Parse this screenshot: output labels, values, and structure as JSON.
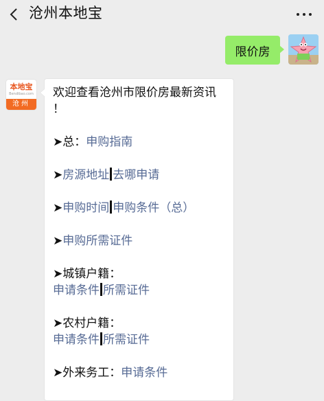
{
  "header": {
    "back_icon": "chevron-left-icon",
    "title": "沧州本地宝",
    "more_icon": "ellipsis-icon"
  },
  "outgoing_message": {
    "text": "限价房"
  },
  "account_avatar": {
    "logo_text": "本地宝",
    "logo_subtext": "Bendibao.com",
    "city": "沧州"
  },
  "reply": {
    "intro_line1": "欢迎查看沧州市限价房最新资讯",
    "intro_line2": "！",
    "items": [
      {
        "prefix": "➤总：",
        "links": [
          "申购指南"
        ]
      },
      {
        "prefix": "➤",
        "links": [
          "房源地址",
          "去哪申请"
        ]
      },
      {
        "prefix": "➤",
        "links": [
          "申购时间",
          "申购条件（总）"
        ]
      },
      {
        "prefix": "➤",
        "links": [
          "申购所需证件"
        ]
      },
      {
        "prefix": "➤城镇户籍：",
        "links": [
          "申请条件",
          "所需证件"
        ]
      },
      {
        "prefix": "➤农村户籍：",
        "links": [
          "申请条件",
          "所需证件"
        ]
      },
      {
        "prefix": "➤外来务工：",
        "links": [
          "申请条件"
        ]
      }
    ]
  },
  "colors": {
    "background": "#ededed",
    "outgoing_bubble": "#95ec69",
    "link": "#576b95",
    "logo_orange": "#f26b23"
  }
}
